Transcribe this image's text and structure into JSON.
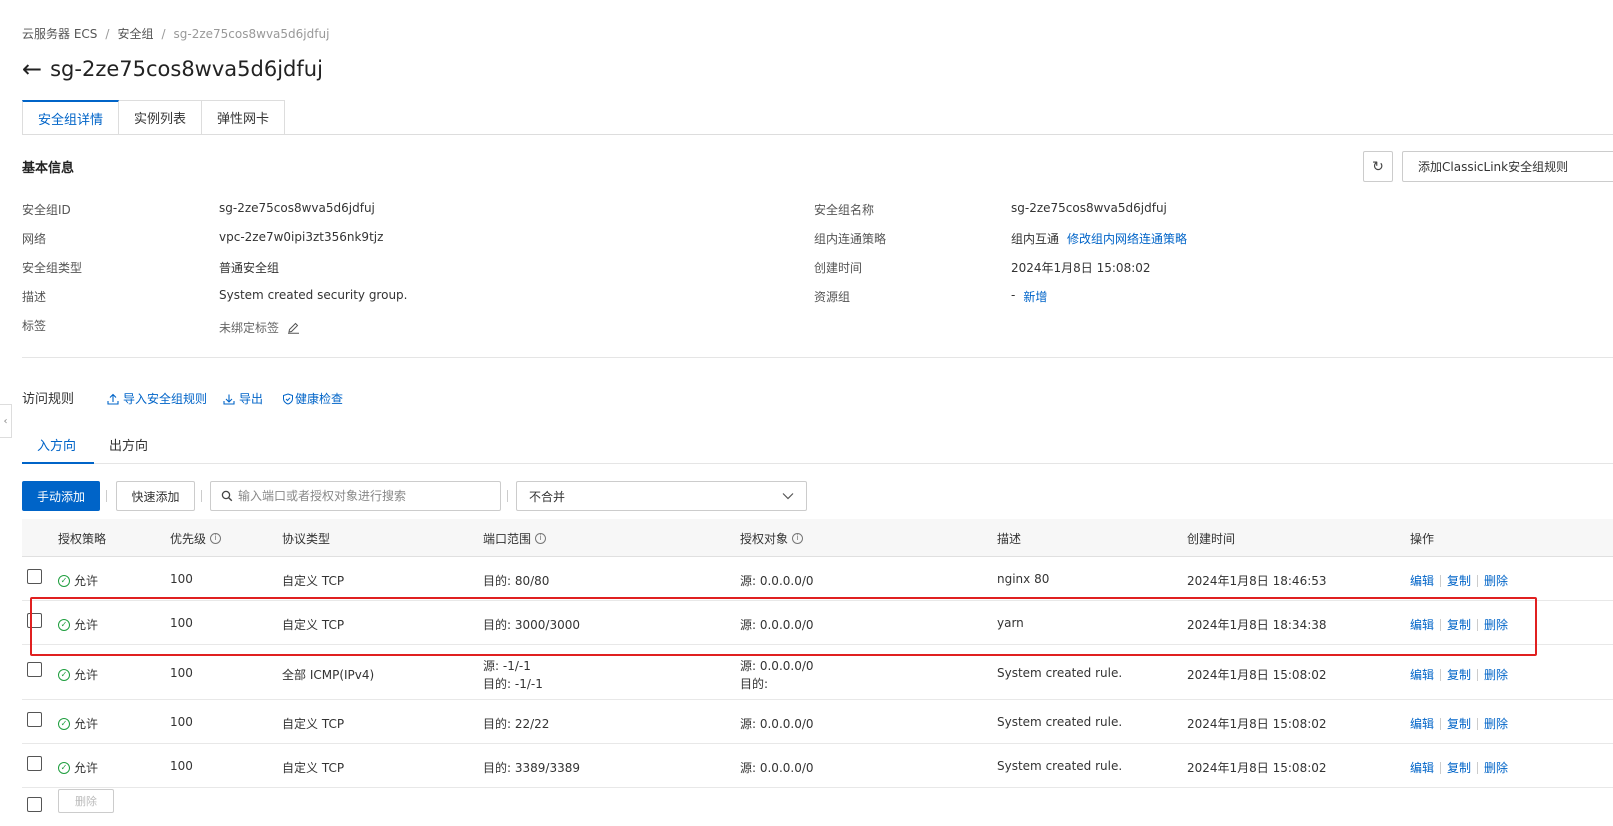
{
  "breadcrumb": {
    "item1": "云服务器 ECS",
    "sep": "/",
    "item2": "安全组",
    "current": "sg-2ze75cos8wva5d6jdfuj"
  },
  "page": {
    "back_icon": "←",
    "title": "sg-2ze75cos8wva5d6jdfuj"
  },
  "tabs": [
    {
      "label": "安全组详情"
    },
    {
      "label": "实例列表"
    },
    {
      "label": "弹性网卡"
    }
  ],
  "basic_info": {
    "title": "基本信息",
    "refresh_icon": "↻",
    "classic_link_button": "添加ClassicLink安全组规则",
    "left": [
      {
        "label": "安全组ID",
        "value": "sg-2ze75cos8wva5d6jdfuj"
      },
      {
        "label": "网络",
        "value": "vpc-2ze7w0ipi3zt356nk9tjz"
      },
      {
        "label": "安全组类型",
        "value": "普通安全组"
      },
      {
        "label": "描述",
        "value": "System created security group."
      },
      {
        "label": "标签",
        "value": "未绑定标签"
      }
    ],
    "right": [
      {
        "label": "安全组名称",
        "value": "sg-2ze75cos8wva5d6jdfuj"
      },
      {
        "label": "组内连通策略",
        "value": "组内互通",
        "link": "修改组内网络连通策略"
      },
      {
        "label": "创建时间",
        "value": "2024年1月8日 15:08:02"
      },
      {
        "label": "资源组",
        "value": "-",
        "link": "新增"
      }
    ]
  },
  "rules": {
    "title": "访问规则",
    "import_link": "导入安全组规则",
    "export_link": "导出",
    "health_link": "健康检查",
    "direction_tabs": [
      {
        "label": "入方向"
      },
      {
        "label": "出方向"
      }
    ],
    "manual_add": "手动添加",
    "quick_add": "快速添加",
    "search_placeholder": "输入端口或者授权对象进行搜索",
    "merge_select": "不合并",
    "columns": [
      "授权策略",
      "优先级",
      "协议类型",
      "端口范围",
      "授权对象",
      "描述",
      "创建时间",
      "操作"
    ],
    "rows": [
      {
        "policy": "允许",
        "priority": "100",
        "protocol": "自定义 TCP",
        "port1": "目的: 80/80",
        "port2": "",
        "auth1": "源: 0.0.0.0/0",
        "auth2": "",
        "desc": "nginx 80",
        "created": "2024年1月8日 18:46:53"
      },
      {
        "policy": "允许",
        "priority": "100",
        "protocol": "自定义 TCP",
        "port1": "目的: 3000/3000",
        "port2": "",
        "auth1": "源: 0.0.0.0/0",
        "auth2": "",
        "desc": "yarn",
        "created": "2024年1月8日 18:34:38"
      },
      {
        "policy": "允许",
        "priority": "100",
        "protocol": "全部 ICMP(IPv4)",
        "port1": "源: -1/-1",
        "port2": "目的: -1/-1",
        "auth1": "源: 0.0.0.0/0",
        "auth2": "目的:",
        "desc": "System created rule.",
        "created": "2024年1月8日 15:08:02"
      },
      {
        "policy": "允许",
        "priority": "100",
        "protocol": "自定义 TCP",
        "port1": "目的: 22/22",
        "port2": "",
        "auth1": "源: 0.0.0.0/0",
        "auth2": "",
        "desc": "System created rule.",
        "created": "2024年1月8日 15:08:02"
      },
      {
        "policy": "允许",
        "priority": "100",
        "protocol": "自定义 TCP",
        "port1": "目的: 3389/3389",
        "port2": "",
        "auth1": "源: 0.0.0.0/0",
        "auth2": "",
        "desc": "System created rule.",
        "created": "2024年1月8日 15:08:02"
      }
    ],
    "ops": {
      "edit": "编辑",
      "copy": "复制",
      "delete": "删除"
    },
    "bottom_button": "删除"
  },
  "colors": {
    "accent": "#0064c8",
    "allow_green": "#1e9e3e",
    "highlight_red": "#e02020"
  }
}
